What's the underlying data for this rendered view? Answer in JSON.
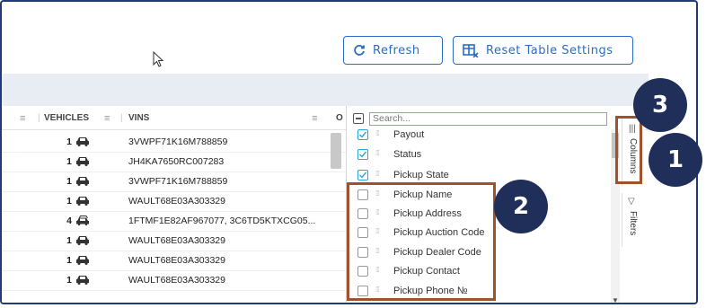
{
  "toolbar": {
    "refresh_label": "Refresh",
    "reset_label": "Reset Table Settings"
  },
  "table": {
    "col_vehicles": "VEHICLES",
    "col_vins": "VINS",
    "col_partial": "O",
    "rows": [
      {
        "count": "1",
        "vin": "3VWPF71K16M788859"
      },
      {
        "count": "1",
        "vin": "JH4KA7650RC007283"
      },
      {
        "count": "1",
        "vin": "3VWPF71K16M788859"
      },
      {
        "count": "1",
        "vin": "WAULT68E03A303329"
      },
      {
        "count": "4",
        "vin": "1FTMF1E82AF967077, 3C6TD5KTXCG05..."
      },
      {
        "count": "1",
        "vin": "WAULT68E03A303329"
      },
      {
        "count": "1",
        "vin": "WAULT68E03A303329"
      },
      {
        "count": "1",
        "vin": "WAULT68E03A303329"
      }
    ]
  },
  "columns_panel": {
    "search_placeholder": "Search...",
    "items": [
      {
        "label": "Payout",
        "checked": true
      },
      {
        "label": "Status",
        "checked": true
      },
      {
        "label": "Pickup State",
        "checked": true
      },
      {
        "label": "Pickup Name",
        "checked": false
      },
      {
        "label": "Pickup Address",
        "checked": false
      },
      {
        "label": "Pickup Auction Code",
        "checked": false
      },
      {
        "label": "Pickup Dealer Code",
        "checked": false
      },
      {
        "label": "Pickup Contact",
        "checked": false
      },
      {
        "label": "Pickup Phone №",
        "checked": false
      }
    ]
  },
  "side_tabs": {
    "columns": "Columns",
    "filters": "Filters"
  },
  "badges": [
    "1",
    "2",
    "3"
  ],
  "colors": {
    "accent": "#2b6cc4",
    "badge": "#1f2f5a",
    "highlight_box": "#a0522d",
    "checkbox_on": "#2ba6d9"
  }
}
